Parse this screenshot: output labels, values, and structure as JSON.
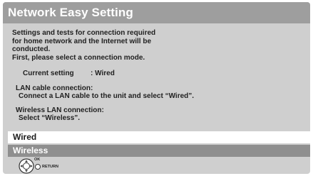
{
  "screen": {
    "title": "Network Easy Setting",
    "intro_lines": [
      "Settings and tests for connection required",
      "for home network and the Internet will be",
      "conducted.",
      "First, please select a connection mode."
    ],
    "current_setting_label": "Current setting",
    "current_setting_value": ": Wired",
    "lan_heading": "LAN cable connection:",
    "lan_desc": "Connect a LAN cable to the unit and select “Wired”.",
    "wireless_heading": "Wireless LAN connection:",
    "wireless_desc": "Select “Wireless”."
  },
  "options": [
    {
      "label": "Wired",
      "state": "selected"
    },
    {
      "label": "Wireless",
      "state": "focused"
    }
  ],
  "controls": {
    "dpad_icon": "dpad-icon",
    "ok_label": "OK",
    "return_icon": "return-button-icon",
    "return_label": "RETURN"
  },
  "colors": {
    "background": "#cfcfcf",
    "title_bar": "#9e9e9e",
    "selected_row": "#ffffff",
    "focused_row": "#8f8f8f"
  }
}
